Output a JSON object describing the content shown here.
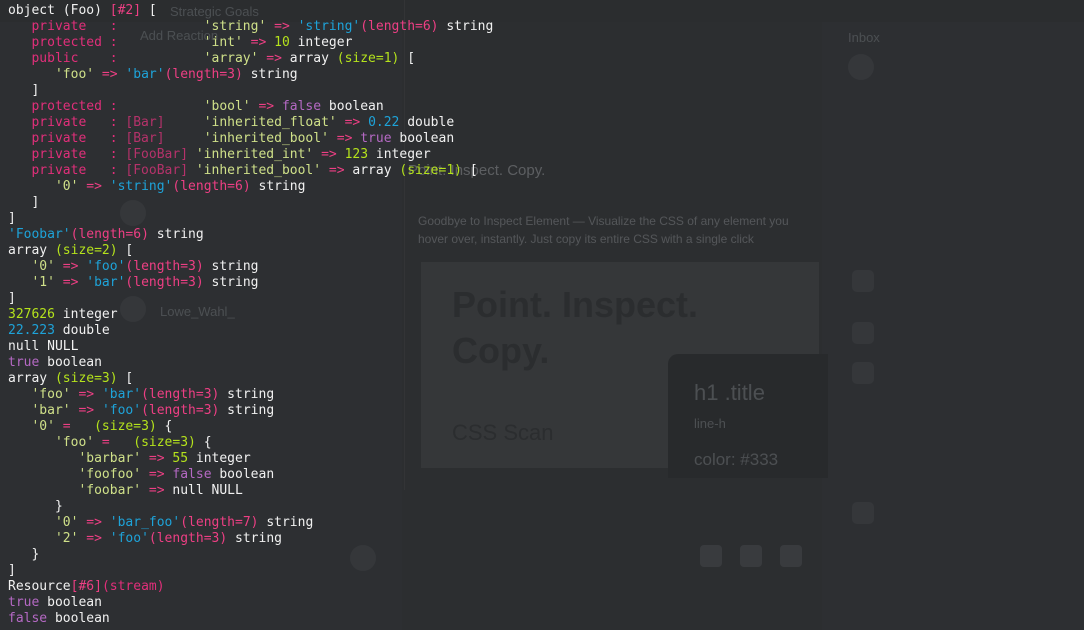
{
  "background": {
    "panel_text": [
      "Strategic Goals",
      "Add Reaction",
      "Inbox"
    ],
    "headline": "Point. Inspect. Copy.",
    "body": "Goodbye to Inspect Element — Visualize the CSS of any element you hover over, instantly. Just copy its entire CSS with a single click",
    "card_title": "Point. Inspect. Copy.",
    "card_subtitle": "CSS Scan",
    "dark_card_title": "h1 .title",
    "dark_card_meta": "line-h",
    "dark_card_value": "color: #333",
    "user_name": "Lowe_Wahl_"
  },
  "colors": {
    "keyword": "#e12f7a",
    "classname": "#b5326a",
    "string": "#1ea3d9",
    "key": "#cfe089",
    "number": "#b5e31c",
    "boolean": "#b569c4",
    "meta": "#ee3f84",
    "text": "#f1f1f1",
    "background": "#2d2f31"
  },
  "lines": [
    [
      [
        "w",
        "object (Foo) "
      ],
      [
        "l",
        "[#2]"
      ],
      [
        "w",
        " ["
      ]
    ],
    [
      [
        "w",
        "   "
      ],
      [
        "k",
        "private   :"
      ],
      [
        "w",
        "           "
      ],
      [
        "q",
        "'string'"
      ],
      [
        "l",
        " => "
      ],
      [
        "s",
        "'string'"
      ],
      [
        "l",
        "(length=6)"
      ],
      [
        "rt",
        " string"
      ]
    ],
    [
      [
        "w",
        "   "
      ],
      [
        "k",
        "protected :"
      ],
      [
        "w",
        "           "
      ],
      [
        "q",
        "'int'"
      ],
      [
        "l",
        " => "
      ],
      [
        "n",
        "10"
      ],
      [
        "rt",
        " integer"
      ]
    ],
    [
      [
        "w",
        "   "
      ],
      [
        "k",
        "public    :"
      ],
      [
        "w",
        "           "
      ],
      [
        "q",
        "'array'"
      ],
      [
        "l",
        " => "
      ],
      [
        "rt",
        "array "
      ],
      [
        "n",
        "(size=1)"
      ],
      [
        "w",
        " ["
      ]
    ],
    [
      [
        "w",
        "      "
      ],
      [
        "q",
        "'foo'"
      ],
      [
        "l",
        " => "
      ],
      [
        "s",
        "'bar'"
      ],
      [
        "l",
        "(length=3)"
      ],
      [
        "rt",
        " string"
      ]
    ],
    [
      [
        "w",
        "   ]"
      ]
    ],
    [
      [
        "w",
        "   "
      ],
      [
        "k",
        "protected :"
      ],
      [
        "w",
        "           "
      ],
      [
        "q",
        "'bool'"
      ],
      [
        "l",
        " => "
      ],
      [
        "b",
        "false"
      ],
      [
        "rt",
        " boolean"
      ]
    ],
    [
      [
        "w",
        "   "
      ],
      [
        "k",
        "private   :"
      ],
      [
        "w",
        " "
      ],
      [
        "c",
        "[Bar]"
      ],
      [
        "w",
        "     "
      ],
      [
        "q",
        "'inherited_float'"
      ],
      [
        "l",
        " => "
      ],
      [
        "s",
        "0.22"
      ],
      [
        "rt",
        " double"
      ]
    ],
    [
      [
        "w",
        "   "
      ],
      [
        "k",
        "private   :"
      ],
      [
        "w",
        " "
      ],
      [
        "c",
        "[Bar]"
      ],
      [
        "w",
        "     "
      ],
      [
        "q",
        "'inherited_bool'"
      ],
      [
        "l",
        " => "
      ],
      [
        "b",
        "true"
      ],
      [
        "rt",
        " boolean"
      ]
    ],
    [
      [
        "w",
        "   "
      ],
      [
        "k",
        "private   :"
      ],
      [
        "w",
        " "
      ],
      [
        "c",
        "[FooBar]"
      ],
      [
        "w",
        " "
      ],
      [
        "q",
        "'inherited_int'"
      ],
      [
        "l",
        " => "
      ],
      [
        "n",
        "123"
      ],
      [
        "rt",
        " integer"
      ]
    ],
    [
      [
        "w",
        "   "
      ],
      [
        "k",
        "private   :"
      ],
      [
        "w",
        " "
      ],
      [
        "c",
        "[FooBar]"
      ],
      [
        "w",
        " "
      ],
      [
        "q",
        "'inherited_bool'"
      ],
      [
        "l",
        " => "
      ],
      [
        "rt",
        "array "
      ],
      [
        "n",
        "(size=1)"
      ],
      [
        "w",
        " ["
      ]
    ],
    [
      [
        "w",
        "      "
      ],
      [
        "q",
        "'0'"
      ],
      [
        "l",
        " => "
      ],
      [
        "s",
        "'string'"
      ],
      [
        "l",
        "(length=6)"
      ],
      [
        "rt",
        " string"
      ]
    ],
    [
      [
        "w",
        "   ]"
      ]
    ],
    [
      [
        "w",
        "]"
      ]
    ],
    [
      [
        "s",
        "'Foobar'"
      ],
      [
        "l",
        "(length=6)"
      ],
      [
        "rt",
        " string"
      ]
    ],
    [
      [
        "rt",
        "array "
      ],
      [
        "n",
        "(size=2)"
      ],
      [
        "w",
        " ["
      ]
    ],
    [
      [
        "w",
        "   "
      ],
      [
        "q",
        "'0'"
      ],
      [
        "l",
        " => "
      ],
      [
        "s",
        "'foo'"
      ],
      [
        "l",
        "(length=3)"
      ],
      [
        "rt",
        " string"
      ]
    ],
    [
      [
        "w",
        "   "
      ],
      [
        "q",
        "'1'"
      ],
      [
        "l",
        " => "
      ],
      [
        "s",
        "'bar'"
      ],
      [
        "l",
        "(length=3)"
      ],
      [
        "rt",
        " string"
      ]
    ],
    [
      [
        "w",
        "]"
      ]
    ],
    [
      [
        "n",
        "327626"
      ],
      [
        "rt",
        " integer"
      ]
    ],
    [
      [
        "s",
        "22.223"
      ],
      [
        "rt",
        " double"
      ]
    ],
    [
      [
        "rt",
        "null NULL"
      ]
    ],
    [
      [
        "b",
        "true"
      ],
      [
        "rt",
        " boolean"
      ]
    ],
    [
      [
        "rt",
        "array "
      ],
      [
        "n",
        "(size=3)"
      ],
      [
        "w",
        " ["
      ]
    ],
    [
      [
        "w",
        "   "
      ],
      [
        "q",
        "'foo'"
      ],
      [
        "l",
        " => "
      ],
      [
        "s",
        "'bar'"
      ],
      [
        "l",
        "(length=3)"
      ],
      [
        "rt",
        " string"
      ]
    ],
    [
      [
        "w",
        "   "
      ],
      [
        "q",
        "'bar'"
      ],
      [
        "l",
        " => "
      ],
      [
        "s",
        "'foo'"
      ],
      [
        "l",
        "(length=3)"
      ],
      [
        "rt",
        " string"
      ]
    ],
    [
      [
        "w",
        "   "
      ],
      [
        "q",
        "'0'"
      ],
      [
        "l",
        " =  "
      ],
      [
        "n",
        " (size=3)"
      ],
      [
        "w",
        " {"
      ]
    ],
    [
      [
        "w",
        "      "
      ],
      [
        "q",
        "'foo'"
      ],
      [
        "l",
        " =  "
      ],
      [
        "n",
        " (size=3)"
      ],
      [
        "w",
        " {"
      ]
    ],
    [
      [
        "w",
        "         "
      ],
      [
        "q",
        "'barbar'"
      ],
      [
        "l",
        " => "
      ],
      [
        "n",
        "55"
      ],
      [
        "rt",
        " integer"
      ]
    ],
    [
      [
        "w",
        "         "
      ],
      [
        "q",
        "'foofoo'"
      ],
      [
        "l",
        " => "
      ],
      [
        "b",
        "false"
      ],
      [
        "rt",
        " boolean"
      ]
    ],
    [
      [
        "w",
        "         "
      ],
      [
        "q",
        "'foobar'"
      ],
      [
        "l",
        " => "
      ],
      [
        "rt",
        "null NULL"
      ]
    ],
    [
      [
        "w",
        "      }"
      ]
    ],
    [
      [
        "w",
        "      "
      ],
      [
        "q",
        "'0'"
      ],
      [
        "l",
        " => "
      ],
      [
        "s",
        "'bar_foo'"
      ],
      [
        "l",
        "(length=7)"
      ],
      [
        "rt",
        " string"
      ]
    ],
    [
      [
        "w",
        "      "
      ],
      [
        "q",
        "'2'"
      ],
      [
        "l",
        " => "
      ],
      [
        "s",
        "'foo'"
      ],
      [
        "l",
        "(length=3)"
      ],
      [
        "rt",
        " string"
      ]
    ],
    [
      [
        "w",
        "   }"
      ]
    ],
    [
      [
        "w",
        "]"
      ]
    ],
    [
      [
        "rt",
        "Resource"
      ],
      [
        "l",
        "[#6]"
      ],
      [
        "k",
        "(stream)"
      ]
    ],
    [
      [
        "b",
        "true"
      ],
      [
        "rt",
        " boolean"
      ]
    ],
    [
      [
        "b",
        "false"
      ],
      [
        "rt",
        " boolean"
      ]
    ]
  ]
}
